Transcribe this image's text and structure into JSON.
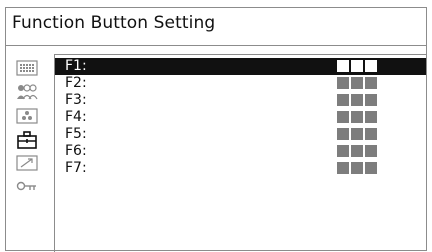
{
  "window": {
    "title": "Function Button Setting"
  },
  "sidebar": {
    "icons": [
      {
        "name": "menu-grid-icon",
        "selected": false
      },
      {
        "name": "users-icon",
        "selected": false
      },
      {
        "name": "camera-dots-icon",
        "selected": false
      },
      {
        "name": "toolbox-icon",
        "selected": true
      },
      {
        "name": "arrow-up-right-icon",
        "selected": false
      },
      {
        "name": "key-icon",
        "selected": false
      }
    ]
  },
  "function_buttons": [
    {
      "label": "F1:",
      "selected": true
    },
    {
      "label": "F2:",
      "selected": false
    },
    {
      "label": "F3:",
      "selected": false
    },
    {
      "label": "F4:",
      "selected": false
    },
    {
      "label": "F5:",
      "selected": false
    },
    {
      "label": "F6:",
      "selected": false
    },
    {
      "label": "F7:",
      "selected": false
    }
  ],
  "colors": {
    "highlight_bg": "#111111",
    "value_squares": "#7d7d7d",
    "value_squares_selected": "#ffffff"
  }
}
